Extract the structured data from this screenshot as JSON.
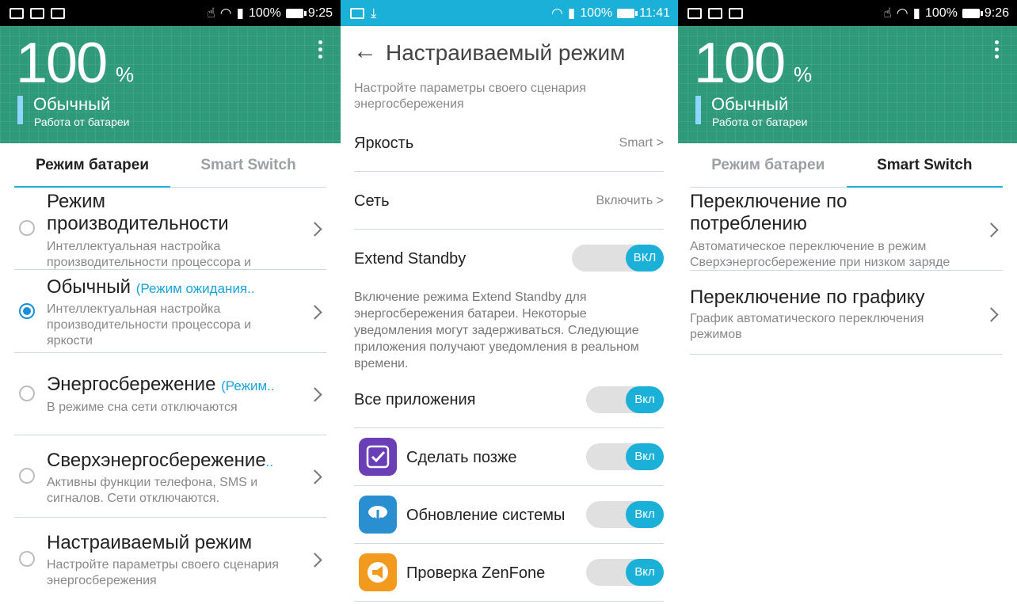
{
  "left": {
    "status": {
      "battery": "100%",
      "time": "9:25"
    },
    "hero": {
      "percent": "100",
      "percent_sign": "%",
      "mode": "Обычный",
      "sub": "Работа от батареи"
    },
    "tabs": [
      {
        "label": "Режим батареи"
      },
      {
        "label": "Smart Switch"
      }
    ],
    "items": [
      {
        "title": "Режим производительности",
        "note": "",
        "desc": "Интеллектуальная настройка производительности процессора и"
      },
      {
        "title": "Обычный",
        "note": "(Режим ожидания..",
        "desc": "Интеллектуальная настройка производительности процессора и яркости"
      },
      {
        "title": "Энергосбережение",
        "note": "(Режим..",
        "desc": "В режиме сна сети отключаются"
      },
      {
        "title": "Сверхэнергосбережение",
        "note": "..",
        "desc": "Активны функции телефона, SMS и сигналов. Сети отключаются."
      },
      {
        "title": "Настраиваемый режим",
        "note": "",
        "desc": "Настройте параметры своего сценария энергосбережения"
      }
    ]
  },
  "middle": {
    "status": {
      "battery": "100%",
      "time": "11:41"
    },
    "title": "Настраиваемый режим",
    "intro": "Настройте параметры своего сценария энергосбережения",
    "brightness": {
      "label": "Яркость",
      "value": "Smart >"
    },
    "network": {
      "label": "Сеть",
      "value": "Включить >"
    },
    "extend": {
      "label": "Extend Standby",
      "toggle": "ВКЛ"
    },
    "extend_desc": "Включение режима Extend Standby для энергосбережения батареи. Некоторые уведомления могут задерживаться. Следующие приложения получают уведомления в реальном времени.",
    "all_apps": {
      "label": "Все приложения",
      "toggle": "Вкл"
    },
    "apps": [
      {
        "label": "Сделать позже",
        "toggle": "Вкл"
      },
      {
        "label": "Обновление системы",
        "toggle": "Вкл"
      },
      {
        "label": "Проверка ZenFone",
        "toggle": "Вкл"
      }
    ]
  },
  "right": {
    "status": {
      "battery": "100%",
      "time": "9:26"
    },
    "hero": {
      "percent": "100",
      "percent_sign": "%",
      "mode": "Обычный",
      "sub": "Работа от батареи"
    },
    "tabs": [
      {
        "label": "Режим батареи"
      },
      {
        "label": "Smart Switch"
      }
    ],
    "items": [
      {
        "title": "Переключение по потреблению",
        "desc": "Автоматическое переключение в режим Сверхэнергосбережение при низком заряде"
      },
      {
        "title": "Переключение по графику",
        "desc": "График автоматического переключения режимов"
      }
    ]
  }
}
